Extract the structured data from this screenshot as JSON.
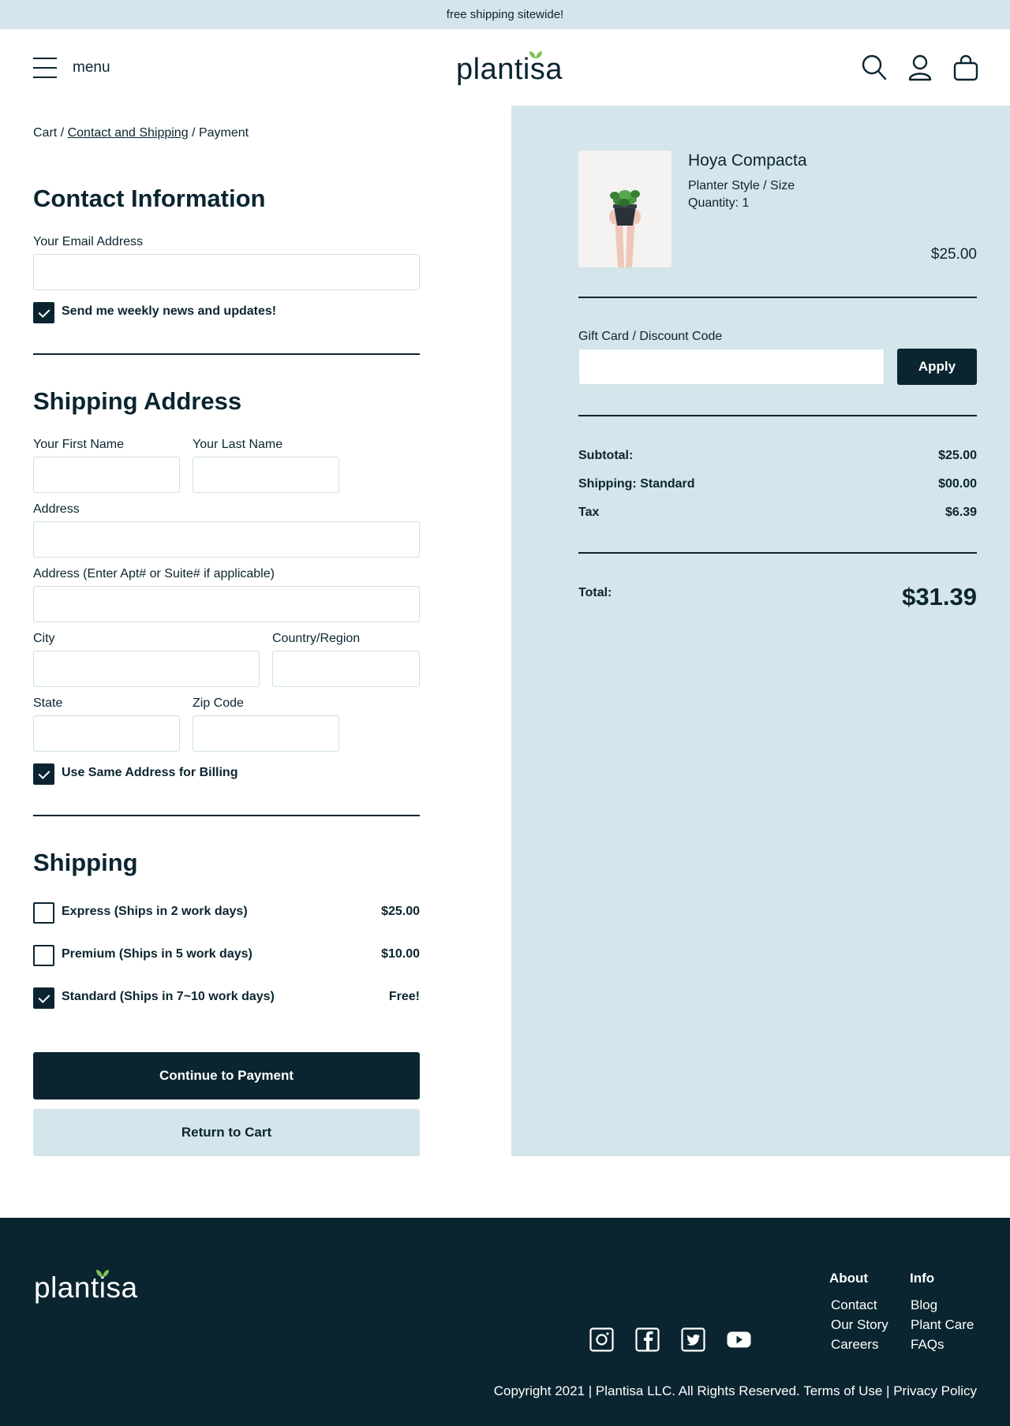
{
  "announcement": "free shipping sitewide!",
  "header": {
    "menu_label": "menu",
    "logo": "plantisa"
  },
  "breadcrumb": {
    "cart": "Cart",
    "contact": "Contact and Shipping",
    "payment": "Payment",
    "sep": "/"
  },
  "contact": {
    "title": "Contact Information",
    "email_label": "Your Email Address",
    "newsletter_label": "Send me weekly news and updates!"
  },
  "shipping_address": {
    "title": "Shipping Address",
    "first_name_label": "Your First Name",
    "last_name_label": "Your Last Name",
    "address_label": "Address",
    "address2_label": "Address (Enter Apt# or Suite# if applicable)",
    "city_label": "City",
    "country_label": "Country/Region",
    "state_label": "State",
    "zip_label": "Zip Code",
    "billing_label": "Use Same Address for Billing"
  },
  "shipping": {
    "title": "Shipping",
    "options": [
      {
        "label": "Express (Ships in 2 work days)",
        "price": "$25.00",
        "checked": false
      },
      {
        "label": "Premium (Ships in 5 work days)",
        "price": "$10.00",
        "checked": false
      },
      {
        "label": "Standard (Ships in 7~10 work days)",
        "price": "Free!",
        "checked": true
      }
    ]
  },
  "actions": {
    "continue": "Continue to Payment",
    "return": "Return to Cart"
  },
  "summary": {
    "product": {
      "name": "Hoya Compacta",
      "variant": "Planter Style / Size",
      "quantity": "Quantity: 1",
      "price": "$25.00"
    },
    "discount_label": "Gift Card / Discount Code",
    "apply": "Apply",
    "subtotal_label": "Subtotal:",
    "subtotal": "$25.00",
    "shipping_label": "Shipping: Standard",
    "shipping": "$00.00",
    "tax_label": "Tax",
    "tax": "$6.39",
    "total_label": "Total:",
    "total": "$31.39"
  },
  "footer": {
    "logo": "plantisa",
    "about_head": "About",
    "about_links": [
      "Contact",
      "Our Story",
      "Careers"
    ],
    "info_head": "Info",
    "info_links": [
      "Blog",
      "Plant Care",
      "FAQs"
    ],
    "copyright": "Copyright 2021 | Plantisa LLC. All Rights Reserved. Terms of Use | Privacy Policy"
  },
  "colors": {
    "navy": "#0b2530",
    "light_blue": "#d4e5eb",
    "leaf_green": "#7cc15a"
  },
  "icons": [
    "menu-icon",
    "search-icon",
    "account-icon",
    "bag-icon",
    "instagram-icon",
    "facebook-icon",
    "twitter-icon",
    "youtube-icon"
  ]
}
